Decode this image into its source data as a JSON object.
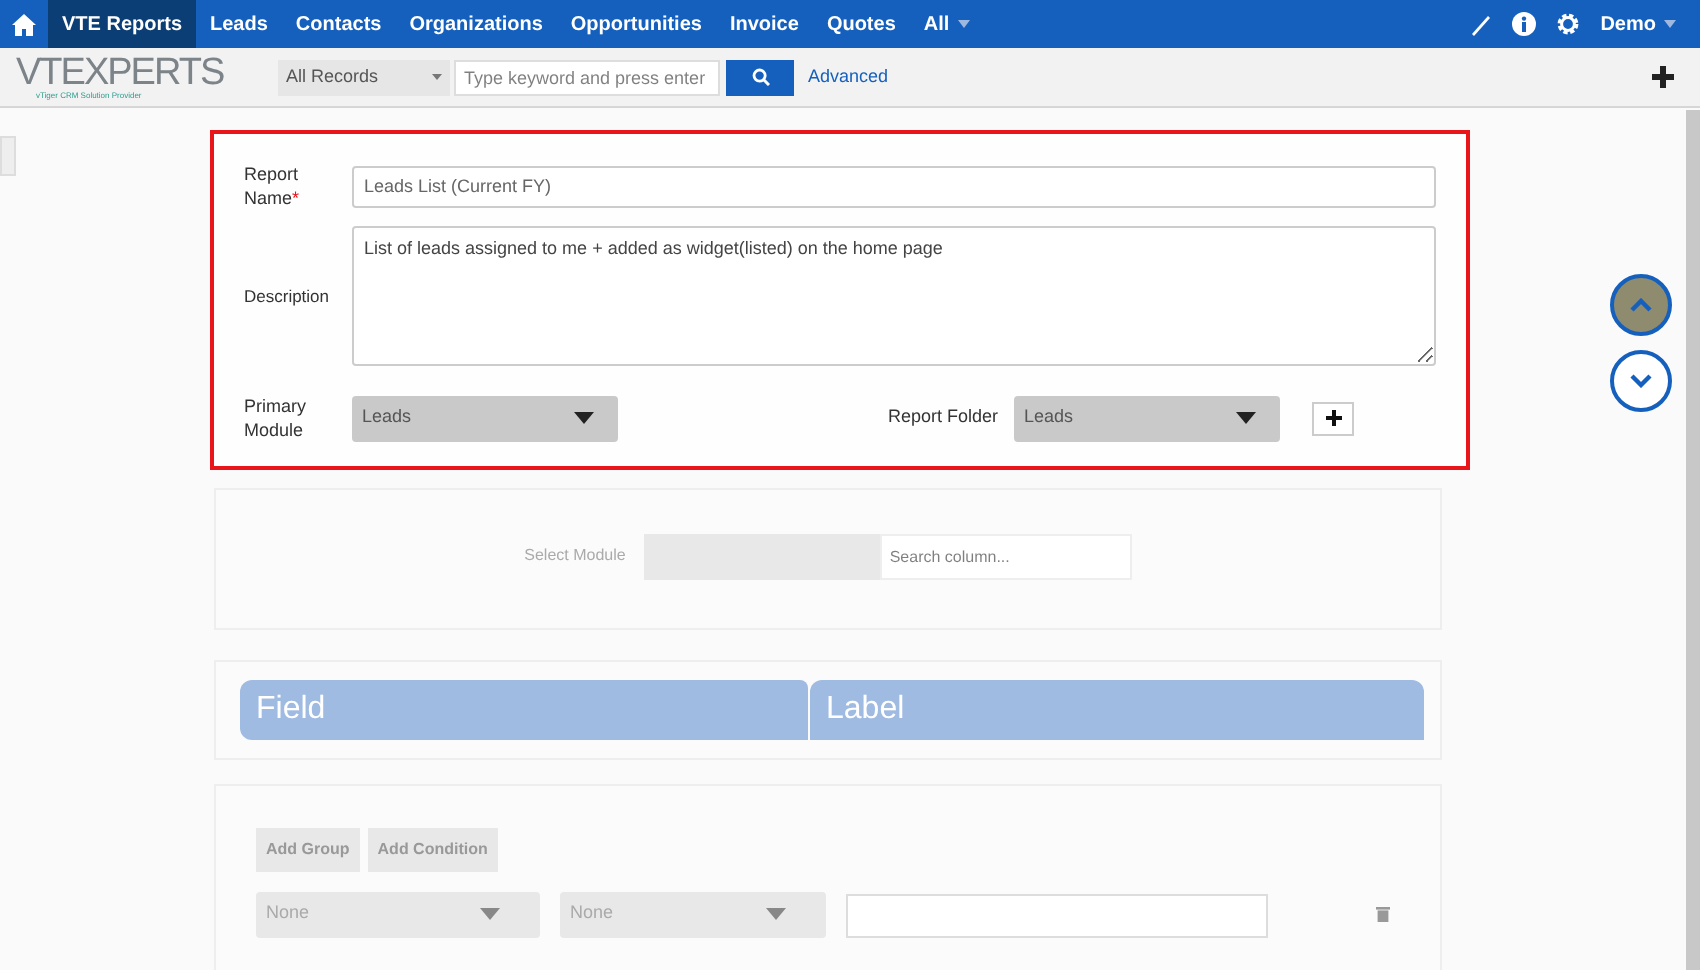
{
  "nav": {
    "items": [
      {
        "label": "VTE Reports",
        "selected": true
      },
      {
        "label": "Leads",
        "selected": false
      },
      {
        "label": "Contacts",
        "selected": false
      },
      {
        "label": "Organizations",
        "selected": false
      },
      {
        "label": "Opportunities",
        "selected": false
      },
      {
        "label": "Invoice",
        "selected": false
      },
      {
        "label": "Quotes",
        "selected": false
      }
    ],
    "all_menu": "All",
    "user": "Demo"
  },
  "header": {
    "logo": "VTEXPERTS",
    "tagline": "vTiger CRM Solution Provider",
    "filter": "All Records",
    "search_placeholder": "Type keyword and press enter",
    "advanced": "Advanced"
  },
  "form": {
    "report_name": {
      "label": "Report Name",
      "required_mark": "*",
      "value": "Leads List (Current FY)"
    },
    "description": {
      "label": "Description",
      "value": "List of leads assigned to me + added as widget(listed) on the home page"
    },
    "primary_module": {
      "label": "Primary Module",
      "value": "Leads"
    },
    "report_folder": {
      "label": "Report Folder",
      "value": "Leads"
    }
  },
  "columns": {
    "label": "Select Module",
    "search_placeholder": "Search column..."
  },
  "table": {
    "columns": [
      "Field",
      "Label"
    ]
  },
  "conditions": {
    "buttons": [
      "Add Group",
      "Add Condition"
    ],
    "selects": [
      "None",
      "None"
    ]
  }
}
